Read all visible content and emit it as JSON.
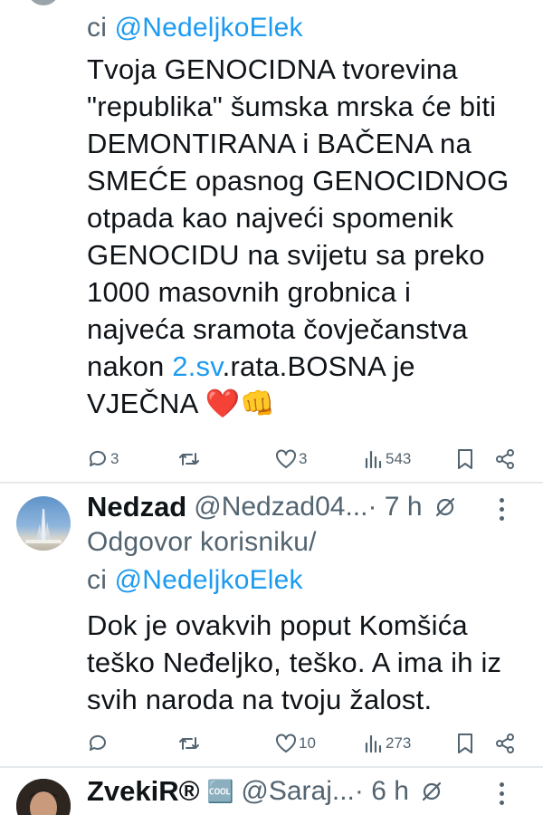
{
  "tweet1": {
    "reply_prefix": "ci ",
    "reply_mention": "@NedeljkoElek",
    "text_lines": [
      "Tvoja GENOCIDNA tvorevina",
      "\"republika\" šumska mrska će biti",
      "DEMONTIRANA i BAČENA na",
      "SMEĆE opasnog GENOCIDNOG",
      "otpada kao najveći spomenik",
      "GENOCIDU na svijetu sa preko",
      "1000 masovnih grobnica i",
      "najveća sramota čovječanstva"
    ],
    "line9_prefix": "nakon ",
    "line9_link": "2.sv",
    "line9_suffix": ".rata.BOSNA je",
    "line10": "VJEČNA ❤️👊",
    "actions": {
      "replies": "3",
      "retweets": "",
      "likes": "3",
      "views": "543"
    }
  },
  "tweet2": {
    "name": "Nedzad",
    "handle": "@Nedzad04...",
    "time": " · 7 h",
    "reply_label": "Odgovor korisniku/",
    "reply_prefix": "ci ",
    "reply_mention": "@NedeljkoElek",
    "text_lines": [
      "Dok je ovakvih poput Komšića",
      "teško Neđeljko, teško. A ima ih iz",
      "svih naroda na tvoju žalost."
    ],
    "actions": {
      "replies": "",
      "retweets": "",
      "likes": "10",
      "views": "273"
    }
  },
  "tweet3": {
    "name": "ZvekiR®",
    "badge": "🆒",
    "handle": "@Saraj...",
    "time": " · 6 h"
  },
  "colors": {
    "accent": "#1d9bf0",
    "muted": "#536471",
    "text": "#0f1419",
    "heart": "#e0245e"
  },
  "icons": [
    "reply-icon",
    "retweet-icon",
    "like-icon",
    "views-icon",
    "bookmark-icon",
    "share-icon",
    "more-icon",
    "grok-icon"
  ]
}
